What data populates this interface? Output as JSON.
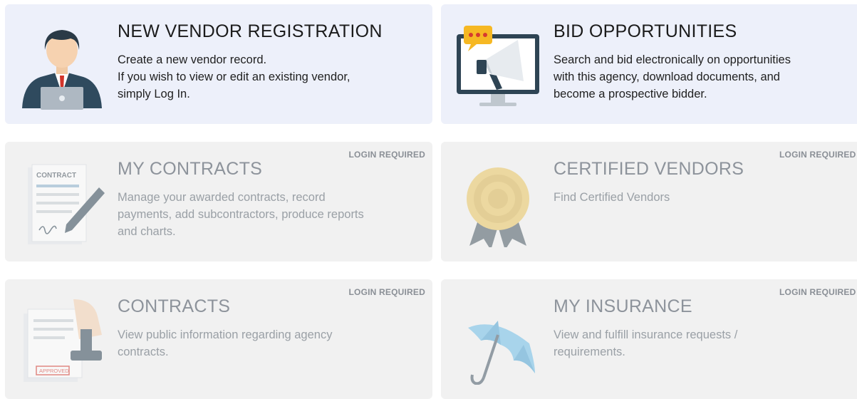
{
  "cards": [
    {
      "title": "NEW VENDOR REGISTRATION",
      "lines": [
        "Create a new vendor record.",
        "If you wish to view or edit an existing vendor,",
        "simply Log In."
      ],
      "badge": "",
      "icon": "businessman-laptop-icon"
    },
    {
      "title": "BID OPPORTUNITIES",
      "lines": [
        "Search and bid electronically on opportunities",
        "with this agency, download documents, and",
        "become a prospective bidder."
      ],
      "badge": "",
      "icon": "megaphone-monitor-icon"
    },
    {
      "title": "MY CONTRACTS",
      "lines": [
        "Manage your awarded contracts, record",
        "payments, add subcontractors, produce reports",
        "and charts."
      ],
      "badge": "LOGIN REQUIRED",
      "icon": "contract-pen-icon",
      "icon_label": "CONTRACT"
    },
    {
      "title": "CERTIFIED VENDORS",
      "lines": [
        "Find Certified Vendors"
      ],
      "badge": "LOGIN REQUIRED",
      "icon": "award-seal-icon"
    },
    {
      "title": "CONTRACTS",
      "lines": [
        "View public information regarding agency",
        "contracts."
      ],
      "badge": "LOGIN REQUIRED",
      "icon": "approved-stamp-icon",
      "icon_label": "APPROVED"
    },
    {
      "title": "MY INSURANCE",
      "lines": [
        "View and fulfill insurance requests /",
        "requirements."
      ],
      "badge": "LOGIN REQUIRED",
      "icon": "umbrella-icon"
    }
  ]
}
